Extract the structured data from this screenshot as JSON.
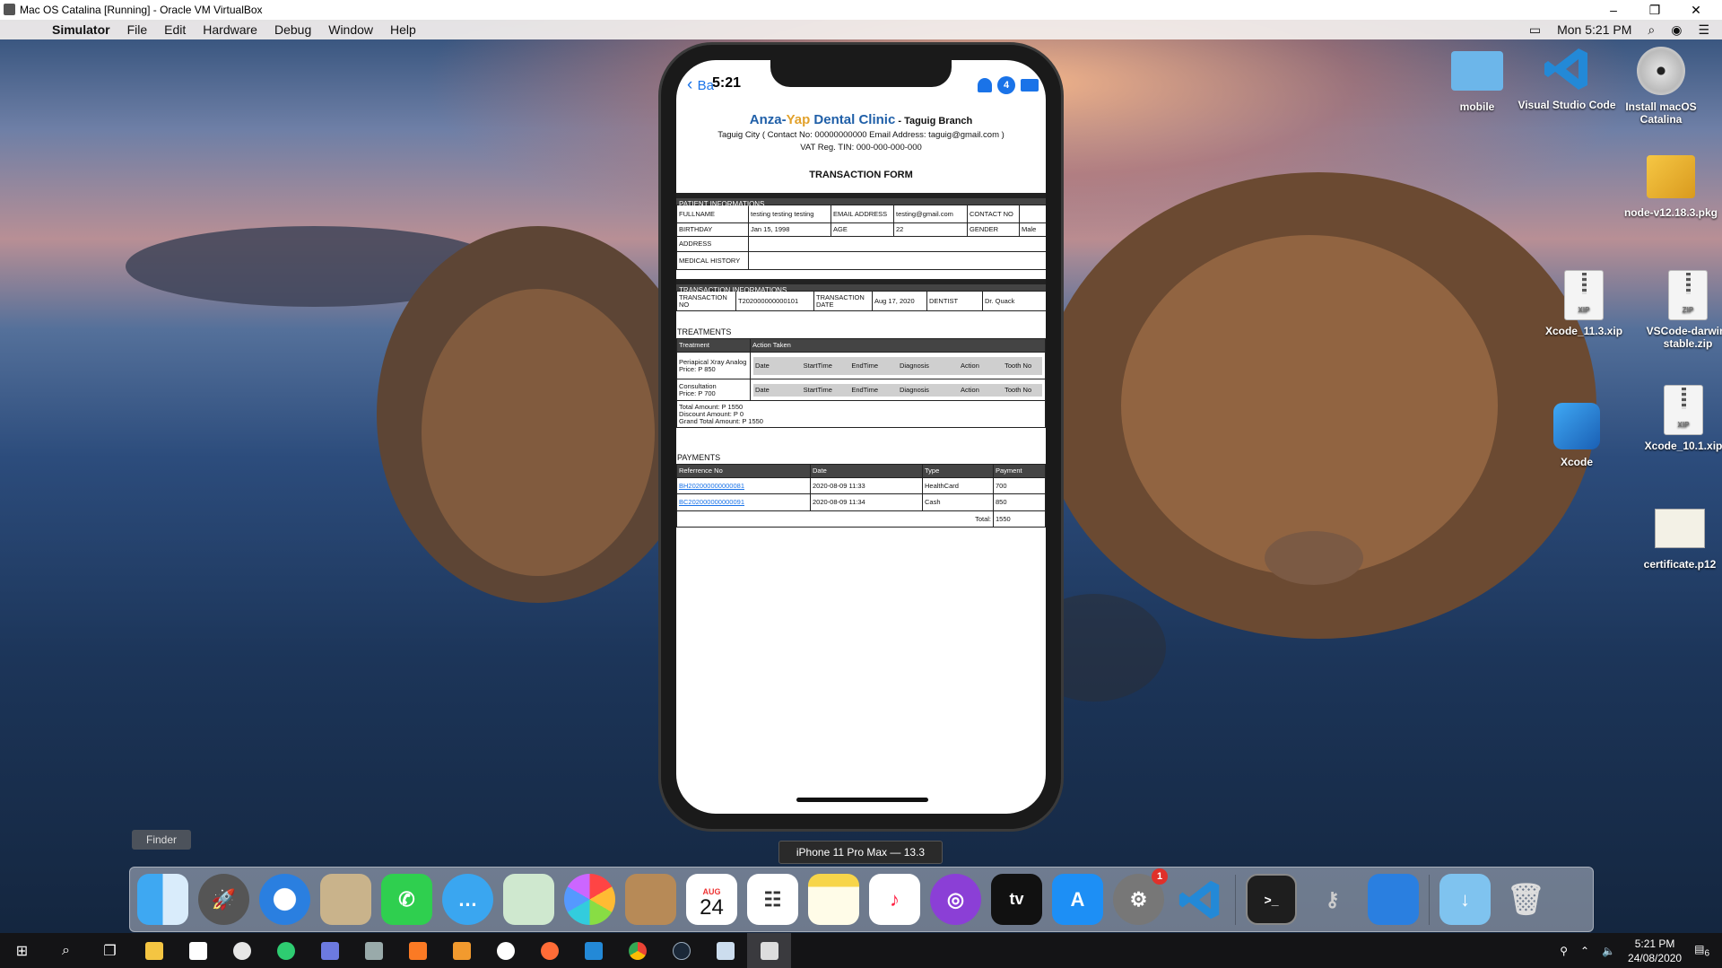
{
  "host_window": {
    "title": "Mac OS Catalina [Running] - Oracle VM VirtualBox"
  },
  "menubar": {
    "app": "Simulator",
    "items": [
      "File",
      "Edit",
      "Hardware",
      "Debug",
      "Window",
      "Help"
    ],
    "clock": "Mon 5:21 PM"
  },
  "desktop_icons": [
    {
      "label": "mobile",
      "icon": "folder-icon"
    },
    {
      "label": "Visual Studio Code",
      "icon": "vscode-icon"
    },
    {
      "label": "Install macOS Catalina",
      "icon": "dvd-icon"
    },
    {
      "label": "node-v12.18.3.pkg",
      "icon": "package-icon"
    },
    {
      "label": "Xcode_11.3.xip",
      "icon": "zip-icon"
    },
    {
      "label": "VSCode-darwin-stable.zip",
      "icon": "zip-icon"
    },
    {
      "label": "Xcode",
      "icon": "xcode-icon"
    },
    {
      "label": "Xcode_10.1.xip",
      "icon": "zip-icon"
    },
    {
      "label": "certificate.p12",
      "icon": "certificate-icon"
    }
  ],
  "phone": {
    "status_time": "5:21",
    "back_label": "Ba",
    "notification_count": "4",
    "device_label": "iPhone 11 Pro Max — 13.3"
  },
  "doc": {
    "clinic_part1": "Anza-",
    "clinic_part2": "Yap",
    "clinic_part3": " Dental Clinic",
    "branch": " - Taguig Branch",
    "contact_line": "Taguig City ( Contact No: 00000000000 Email Address: taguig@gmail.com )",
    "vat_line": "VAT Reg. TIN: 000-000-000-000",
    "form_title": "TRANSACTION FORM",
    "patient": {
      "section": "PATIENT INFORMATIONS",
      "fullname_label": "FULLNAME",
      "fullname": "testing testing testing",
      "email_label": "EMAIL ADDRESS",
      "email": "testing@gmail.com",
      "contact_label": "CONTACT NO",
      "contact": "",
      "birthday_label": "BIRTHDAY",
      "birthday": "Jan 15, 1998",
      "age_label": "AGE",
      "age": "22",
      "gender_label": "GENDER",
      "gender": "Male",
      "address_label": "ADDRESS",
      "address": "",
      "history_label": "MEDICAL HISTORY",
      "history": ""
    },
    "transaction": {
      "section": "TRANSACTION INFORMATIONS",
      "no_label": "TRANSACTION NO",
      "no": "T202000000000101",
      "date_label": "TRANSACTION DATE",
      "date": "Aug 17, 2020",
      "dentist_label": "DENTIST",
      "dentist": "Dr. Quack"
    },
    "treatments": {
      "heading": "TREATMENTS",
      "col_treatment": "Treatment",
      "col_action": "Action Taken",
      "sub_headers": [
        "Date",
        "StartTime",
        "EndTime",
        "Diagnosis",
        "Action",
        "Tooth No"
      ],
      "rows": [
        {
          "name": "Periapical Xray Analog",
          "price": "Price: P 850"
        },
        {
          "name": "Consultation",
          "price": "Price: P 700"
        }
      ],
      "total": "Total Amount: P 1550",
      "discount": "Discount Amount: P 0",
      "grand": "Grand Total Amount: P 1550"
    },
    "payments": {
      "heading": "PAYMENTS",
      "headers": [
        "Referrence No",
        "Date",
        "Type",
        "Payment"
      ],
      "rows": [
        {
          "ref": "BH202000000000081",
          "date": "2020-08-09 11:33",
          "type": "HealthCard",
          "amount": "700"
        },
        {
          "ref": "BC202000000000091",
          "date": "2020-08-09 11:34",
          "type": "Cash",
          "amount": "850"
        }
      ],
      "total_label": "Total:",
      "total": "1550"
    }
  },
  "finder_tooltip": "Finder",
  "dock": {
    "calendar_month": "AUG",
    "calendar_day": "24",
    "prefs_badge": "1",
    "tv_label": "tv"
  },
  "taskbar": {
    "time": "5:21 PM",
    "date": "24/08/2020",
    "notif_count": "6"
  }
}
